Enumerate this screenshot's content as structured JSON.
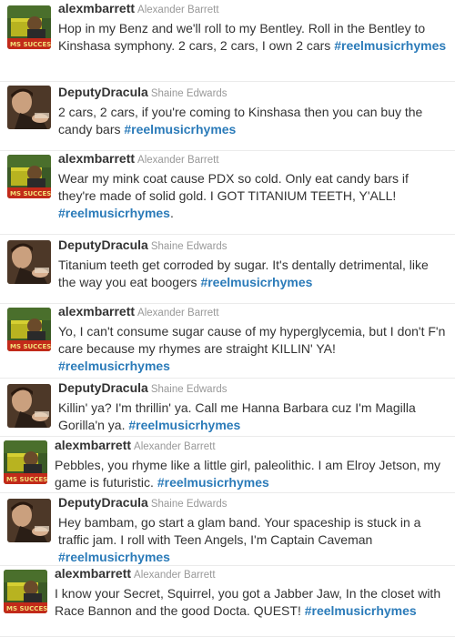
{
  "tweets": [
    {
      "screen_name": "alexmbarrett",
      "full_name": "Alexander Barrett",
      "avatar": "alex-avatar",
      "text": "Hop in my Benz and we'll roll to my Bentley. Roll in the Bentley to Kinshasa symphony. 2 cars, 2 cars, I own 2 cars",
      "hashtag": "#reelmusicrhymes",
      "suffix": ""
    },
    {
      "screen_name": "DeputyDracula",
      "full_name": "Shaine Edwards",
      "avatar": "shaine-avatar",
      "text": "2 cars, 2 cars, if you're coming to Kinshasa then you can buy the candy bars",
      "hashtag": "#reelmusicrhymes",
      "suffix": ""
    },
    {
      "screen_name": "alexmbarrett",
      "full_name": "Alexander Barrett",
      "avatar": "alex-avatar",
      "text": "Wear my mink coat cause PDX so cold. Only eat candy bars if they're made of solid gold. I GOT TITANIUM TEETH, Y'ALL!",
      "hashtag": "#reelmusicrhymes",
      "suffix": "."
    },
    {
      "screen_name": "DeputyDracula",
      "full_name": "Shaine Edwards",
      "avatar": "shaine-avatar",
      "text": "Titanium teeth get corroded by sugar. It's dentally detrimental, like the way you eat boogers",
      "hashtag": "#reelmusicrhymes",
      "suffix": ""
    },
    {
      "screen_name": "alexmbarrett",
      "full_name": "Alexander Barrett",
      "avatar": "alex-avatar",
      "text": "Yo, I can't consume sugar cause of my hyperglycemia, but I don't F'n care because my rhymes are straight KILLIN' YA!",
      "hashtag": "#reelmusicrhymes",
      "suffix": ""
    },
    {
      "screen_name": "DeputyDracula",
      "full_name": "Shaine Edwards",
      "avatar": "shaine-avatar",
      "text": "Killin' ya? I'm thrillin' ya. Call me Hanna Barbara cuz I'm Magilla Gorilla'n ya.",
      "hashtag": "#reelmusicrhymes",
      "suffix": ""
    },
    {
      "screen_name": "alexmbarrett",
      "full_name": "Alexander Barrett",
      "avatar": "alex-avatar",
      "text": "Pebbles, you rhyme like a little girl, paleolithic. I am Elroy Jetson, my game is futuristic.",
      "hashtag": "#reelmusicrhymes",
      "suffix": ""
    },
    {
      "screen_name": "DeputyDracula",
      "full_name": "Shaine Edwards",
      "avatar": "shaine-avatar",
      "text": "Hey bambam, go start a glam band. Your spaceship is stuck in a traffic jam. I roll with Teen Angels, I'm Captain Caveman",
      "hashtag": "#reelmusicrhymes",
      "suffix": ""
    },
    {
      "screen_name": "alexmbarrett",
      "full_name": "Alexander Barrett",
      "avatar": "alex-avatar",
      "text": "I know your Secret, Squirrel, you got a Jabber Jaw, In the closet with Race Bannon and the good Docta. QUEST!",
      "hashtag": "#reelmusicrhymes",
      "suffix": ""
    }
  ],
  "colors": {
    "link": "#2b7bb9",
    "name": "#333333",
    "muted": "#999999"
  }
}
